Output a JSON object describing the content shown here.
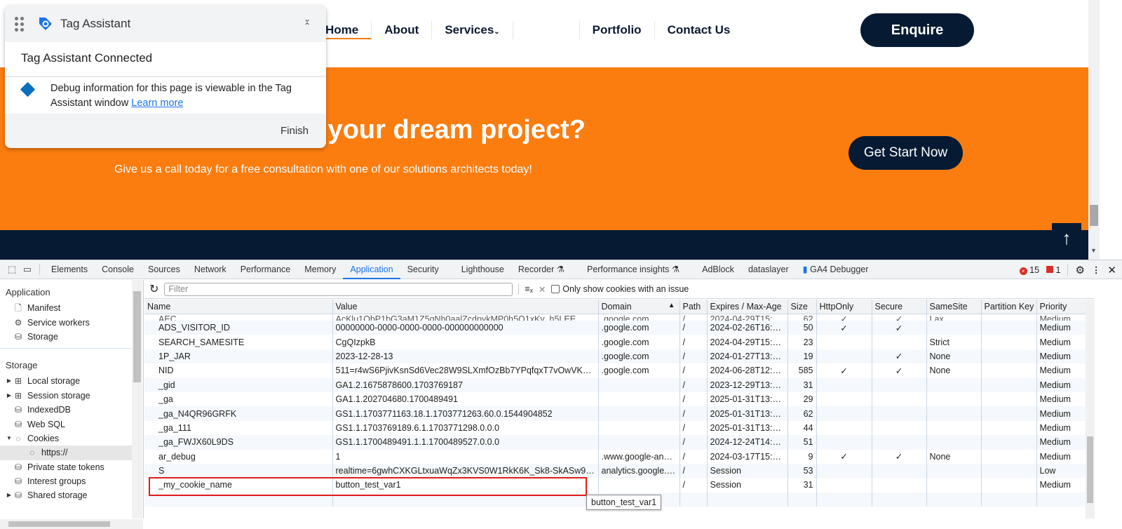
{
  "site": {
    "nav": [
      "Home",
      "About",
      "Services",
      "Portfolio",
      "Contact Us"
    ],
    "services_chevron": "chevron-down-icon",
    "enquire": "Enquire",
    "hero_title": "ted your dream project?",
    "hero_text": "Give us a call today for a free consultation with one of our solutions architects today!",
    "cta": "Get Start Now",
    "to_top": "↑",
    "accent": "#fb7d10",
    "navy": "#061a33"
  },
  "tag_assistant": {
    "title": "Tag Assistant",
    "status": "Tag Assistant Connected",
    "info": "Debug information for this page is viewable in the Tag Assistant window",
    "link": "Learn more",
    "finish": "Finish"
  },
  "devtools": {
    "tabs": [
      "Elements",
      "Console",
      "Sources",
      "Network",
      "Performance",
      "Memory",
      "Application",
      "Security",
      "Lighthouse",
      "Recorder ⚗",
      "Performance insights ⚗",
      "AdBlock",
      "dataslayer",
      "GA4 Debugger"
    ],
    "active_tab": "Application",
    "errors": "15",
    "warnings": "1",
    "sidebar": {
      "app_header": "Application",
      "app_items": [
        "Manifest",
        "Service workers",
        "Storage"
      ],
      "storage_header": "Storage",
      "storage_items": [
        "Local storage",
        "Session storage",
        "IndexedDB",
        "Web SQL",
        "Cookies",
        "https://",
        "Private state tokens",
        "Interest groups",
        "Shared storage"
      ]
    },
    "filter_placeholder": "Filter",
    "only_issues": "Only show cookies with an issue",
    "columns": [
      "Name",
      "Value",
      "Domain",
      "Path",
      "Expires / Max-Age",
      "Size",
      "HttpOnly",
      "Secure",
      "SameSite",
      "Partition Key",
      "Priority"
    ],
    "sort_indicator": "▲",
    "rows": [
      [
        "AEC",
        "AcKlu1QbP1bG3aM1Z5qNb0aalZcdpykMP0h5O1xKy_h5LEE_ALNFA...",
        ".google.com",
        "/",
        "2024-04-29T15:4...",
        "62",
        "✓",
        "✓",
        "Lax",
        "",
        "Medium"
      ],
      [
        "ADS_VISITOR_ID",
        "00000000-0000-0000-0000-000000000000",
        ".google.com",
        "/",
        "2024-02-26T16:4...",
        "50",
        "✓",
        "✓",
        "",
        "",
        "Medium"
      ],
      [
        "SEARCH_SAMESITE",
        "CgQIzpkB",
        ".google.com",
        "/",
        "2024-04-29T15:4...",
        "23",
        "",
        "",
        "Strict",
        "",
        "Medium"
      ],
      [
        "1P_JAR",
        "2023-12-28-13",
        ".google.com",
        "/",
        "2024-01-27T13:0...",
        "19",
        "",
        "✓",
        "None",
        "",
        "Medium"
      ],
      [
        "NID",
        "511=r4wS6PjivKsnSd6Vec28W9SLXmfOzBb7YPqfqxT7vOwVKdHR_...",
        ".google.com",
        "/",
        "2024-06-28T12:5...",
        "585",
        "✓",
        "✓",
        "None",
        "",
        "Medium"
      ],
      [
        "_gid",
        "GA1.2.1675878600.1703769187",
        "",
        "/",
        "2023-12-29T13:4...",
        "31",
        "",
        "",
        "",
        "",
        "Medium"
      ],
      [
        "_ga",
        "GA1.1.202704680.1700489491",
        "",
        "/",
        "2025-01-31T13:4...",
        "29",
        "",
        "",
        "",
        "",
        "Medium"
      ],
      [
        "_ga_N4QR96GRFK",
        "GS1.1.1703771163.18.1.1703771263.60.0.1544904852",
        "",
        "/",
        "2025-01-31T13:4...",
        "62",
        "",
        "",
        "",
        "",
        "Medium"
      ],
      [
        "_ga_111",
        "GS1.1.1703769189.6.1.1703771298.0.0.0",
        "",
        "/",
        "2025-01-31T13:4...",
        "44",
        "",
        "",
        "",
        "",
        "Medium"
      ],
      [
        "_ga_FWJX60L9DS",
        "GS1.1.1700489491.1.1.1700489527.0.0.0",
        "",
        "/",
        "2024-12-24T14:1...",
        "51",
        "",
        "",
        "",
        "",
        "Medium"
      ],
      [
        "ar_debug",
        "1",
        ".www.google-anal...",
        "/",
        "2024-03-17T15:2...",
        "9",
        "✓",
        "✓",
        "None",
        "",
        "Medium"
      ],
      [
        "S",
        "realtime=6gwhCXKGLtxuaWqZx3KVS0W1RkK6K_Sk8-SkASw9vS8",
        "analytics.google.c...",
        "/",
        "Session",
        "53",
        "",
        "",
        "",
        "",
        "Low"
      ],
      [
        "_my_cookie_name",
        "button_test_var1",
        "",
        "/",
        "Session",
        "31",
        "",
        "",
        "",
        "",
        "Medium"
      ]
    ],
    "tooltip": "button_test_var1",
    "highlight_color": "#e21b1b"
  }
}
